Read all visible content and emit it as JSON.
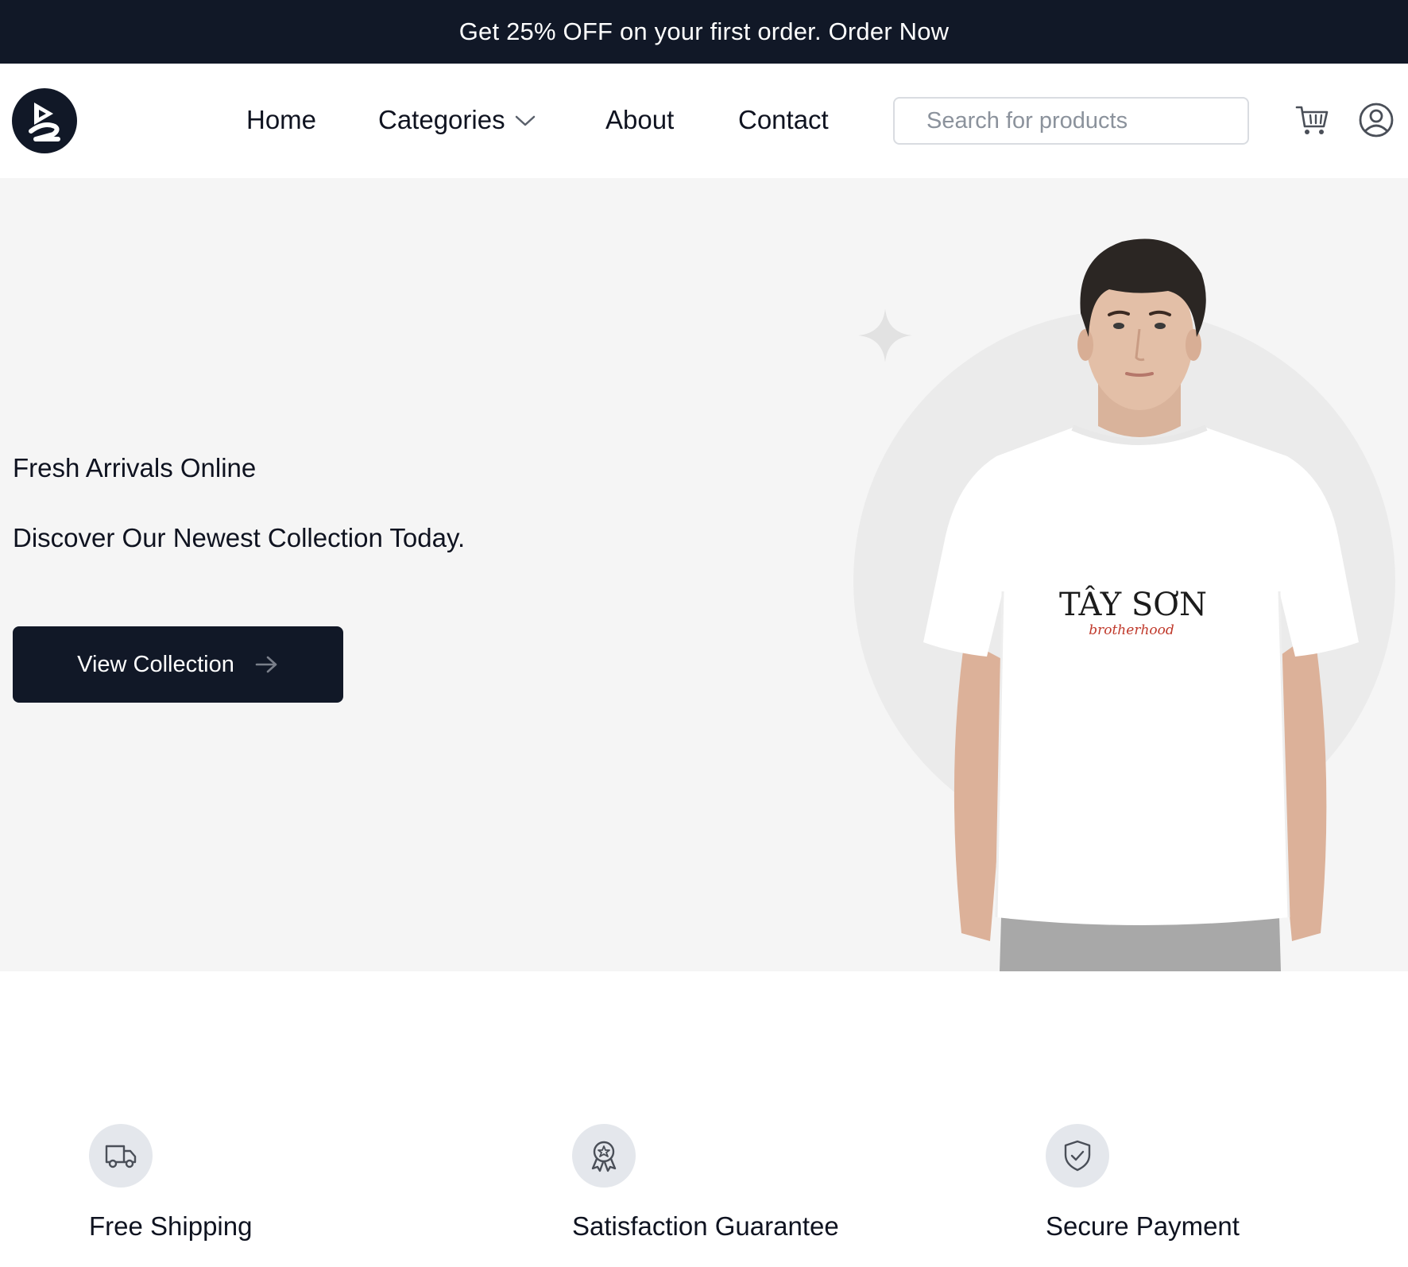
{
  "promo": {
    "text": "Get 25% OFF on your first order. Order Now"
  },
  "logo": {
    "icon": "brand-logo-icon",
    "color": "#111827"
  },
  "nav": {
    "home": "Home",
    "categories": "Categories",
    "about": "About",
    "contact": "Contact"
  },
  "search": {
    "placeholder": "Search for products",
    "value": ""
  },
  "icons": {
    "cart": "cart-icon",
    "user": "user-icon",
    "chevron": "chevron-down-icon",
    "arrow": "arrow-right-icon"
  },
  "hero": {
    "eyebrow": "Fresh Arrivals Online",
    "headline": "Discover Our Newest Collection Today.",
    "cta_label": "View Collection",
    "shirt_print_title": "TÂY SƠN",
    "shirt_print_subtitle": "brotherhood"
  },
  "features": [
    {
      "icon": "truck-icon",
      "label": "Free Shipping"
    },
    {
      "icon": "award-badge-icon",
      "label": "Satisfaction Guarantee"
    },
    {
      "icon": "shield-check-icon",
      "label": "Secure Payment"
    }
  ],
  "colors": {
    "dark": "#111827",
    "hero_bg": "#f5f5f5",
    "feature_icon_bg": "#e4e7ec",
    "accent_red": "#c0392b"
  }
}
